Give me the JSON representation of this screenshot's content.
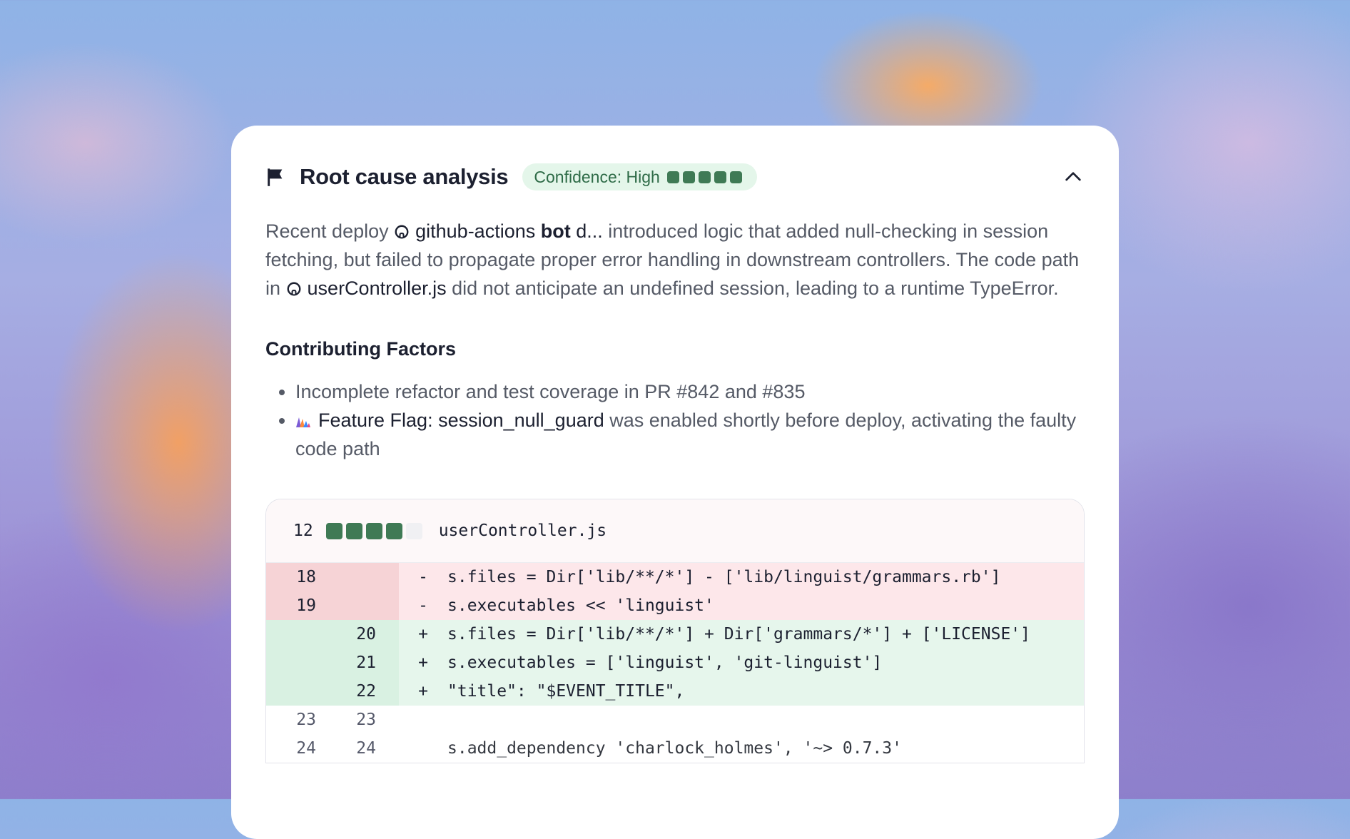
{
  "header": {
    "title": "Root cause analysis",
    "confidence_label": "Confidence: High",
    "confidence_level": 5,
    "confidence_max": 5
  },
  "summary": {
    "part1": "Recent deploy ",
    "deploy_ref_name": "github-actions ",
    "deploy_ref_bold": "bot",
    "deploy_ref_rest": " d...",
    "part2": "  introduced logic that added null-checking in session fetching, but failed to propagate proper error handling in downstream controllers. The code path in ",
    "file_ref": "userController.js",
    "part3": "  did not anticipate an undefined session, leading to a runtime TypeError."
  },
  "factors": {
    "heading": "Contributing Factors",
    "item1": "Incomplete refactor and test coverage in PR #842 and #835",
    "item2_flag": "Feature Flag: session_null_guard",
    "item2_rest": "  was enabled shortly before deploy, activating the faulty code path"
  },
  "diff": {
    "change_count": "12",
    "change_bar_filled": 4,
    "change_bar_total": 5,
    "filename": "userController.js",
    "lines": [
      {
        "type": "del",
        "old": "18",
        "new": "",
        "sign": "-",
        "code": "s.files = Dir['lib/**/*'] - ['lib/linguist/grammars.rb']"
      },
      {
        "type": "del",
        "old": "19",
        "new": "",
        "sign": "-",
        "code": "s.executables << 'linguist'"
      },
      {
        "type": "add",
        "old": "",
        "new": "20",
        "sign": "+",
        "code": "s.files = Dir['lib/**/*'] + Dir['grammars/*'] + ['LICENSE']"
      },
      {
        "type": "add",
        "old": "",
        "new": "21",
        "sign": "+",
        "code": "s.executables = ['linguist', 'git-linguist']"
      },
      {
        "type": "add",
        "old": "",
        "new": "22",
        "sign": "+",
        "code": "\"title\": \"$EVENT_TITLE\","
      },
      {
        "type": "ctx",
        "old": "23",
        "new": "23",
        "sign": "",
        "code": ""
      },
      {
        "type": "ctx",
        "old": "24",
        "new": "24",
        "sign": "",
        "code": "s.add_dependency 'charlock_holmes', '~> 0.7.3'"
      }
    ]
  },
  "colors": {
    "accent_green": "#3f7a55",
    "deleted_bg": "#fde7ea",
    "added_bg": "#e6f6ec"
  }
}
